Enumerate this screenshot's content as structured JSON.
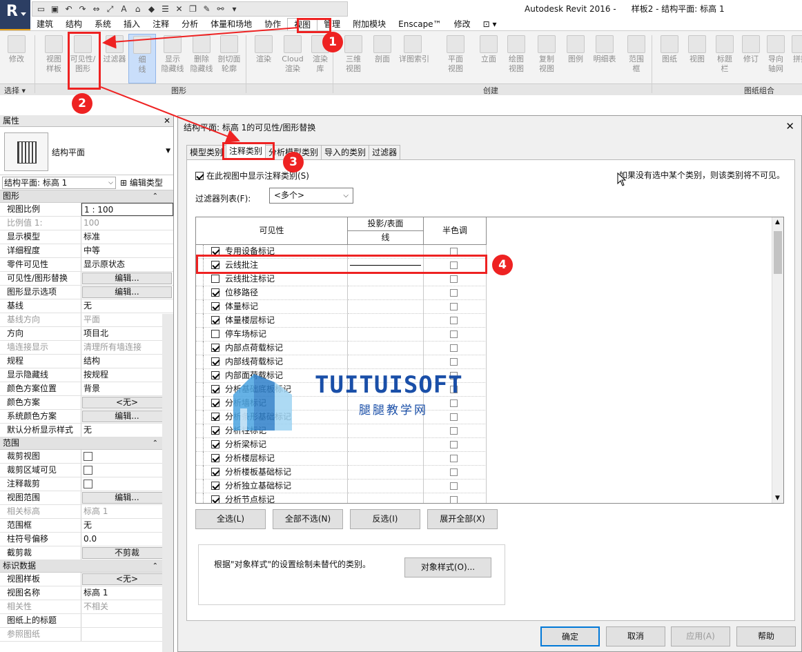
{
  "titlebar": {
    "app_name": "Autodesk Revit 2016 -",
    "doc_title": "样板2 - 结构平面: 标高 1"
  },
  "ribbon_tabs": [
    "建筑",
    "结构",
    "系统",
    "插入",
    "注释",
    "分析",
    "体量和场地",
    "协作",
    "视图",
    "管理",
    "附加模块",
    "Enscape™",
    "修改"
  ],
  "ribbon_buttons": [
    {
      "label": "修改",
      "icon": "cursor-icon"
    },
    {
      "label": "视图\n样板",
      "icon": "view-template-icon"
    },
    {
      "label": "可见性/\n图形",
      "icon": "visibility-graphics-icon"
    },
    {
      "label": "过滤器",
      "icon": "filter-icon"
    },
    {
      "label": "细\n线",
      "icon": "thin-lines-icon"
    },
    {
      "label": "显示\n隐藏线",
      "icon": "show-hidden-lines-icon"
    },
    {
      "label": "删除\n隐藏线",
      "icon": "remove-hidden-lines-icon"
    },
    {
      "label": "剖切面\n轮廓",
      "icon": "cut-profile-icon"
    },
    {
      "label": "渲染",
      "icon": "render-icon"
    },
    {
      "label": "Cloud\n渲染",
      "icon": "cloud-render-icon"
    },
    {
      "label": "渲染\n库",
      "icon": "render-gallery-icon"
    },
    {
      "label": "三维\n视图",
      "icon": "3d-view-icon"
    },
    {
      "label": "剖面",
      "icon": "section-icon"
    },
    {
      "label": "详图索引",
      "icon": "callout-icon"
    },
    {
      "label": "平面\n视图",
      "icon": "plan-view-icon"
    },
    {
      "label": "立面",
      "icon": "elevation-icon"
    },
    {
      "label": "绘图\n视图",
      "icon": "drafting-view-icon"
    },
    {
      "label": "复制\n视图",
      "icon": "duplicate-view-icon"
    },
    {
      "label": "图例",
      "icon": "legend-icon"
    },
    {
      "label": "明细表",
      "icon": "schedule-icon"
    },
    {
      "label": "范围\n框",
      "icon": "scope-box-icon"
    },
    {
      "label": "图纸",
      "icon": "sheet-icon"
    },
    {
      "label": "视图",
      "icon": "view-icon"
    },
    {
      "label": "标题\n栏",
      "icon": "title-block-icon"
    },
    {
      "label": "修订",
      "icon": "revisions-icon"
    },
    {
      "label": "导向\n轴网",
      "icon": "guide-grid-icon"
    },
    {
      "label": "拼接",
      "icon": "matchline-icon"
    }
  ],
  "ribbon_panels": {
    "select": "选择 ▾",
    "graphics": "图形",
    "create": "创建",
    "sheet_composition": "图纸组合"
  },
  "properties": {
    "title": "属性",
    "type_name": "结构平面",
    "view_selector": "结构平面: 标高 1",
    "edit_type": "编辑类型",
    "groups": [
      {
        "name": "图形",
        "rows": [
          {
            "k": "视图比例",
            "v": "1 : 100",
            "kind": "input"
          },
          {
            "k": "比例值 1:",
            "v": "100",
            "kind": "dis"
          },
          {
            "k": "显示模型",
            "v": "标准"
          },
          {
            "k": "详细程度",
            "v": "中等"
          },
          {
            "k": "零件可见性",
            "v": "显示原状态"
          },
          {
            "k": "可见性/图形替换",
            "v": "编辑...",
            "kind": "btn"
          },
          {
            "k": "图形显示选项",
            "v": "编辑...",
            "kind": "btn"
          },
          {
            "k": "基线",
            "v": "无"
          },
          {
            "k": "基线方向",
            "v": "平面",
            "kind": "dis"
          },
          {
            "k": "方向",
            "v": "项目北"
          },
          {
            "k": "墙连接显示",
            "v": "清理所有墙连接",
            "kind": "dis"
          },
          {
            "k": "规程",
            "v": "结构"
          },
          {
            "k": "显示隐藏线",
            "v": "按规程"
          },
          {
            "k": "颜色方案位置",
            "v": "背景"
          },
          {
            "k": "颜色方案",
            "v": "<无>",
            "kind": "btn"
          },
          {
            "k": "系统颜色方案",
            "v": "编辑...",
            "kind": "btn"
          },
          {
            "k": "默认分析显示样式",
            "v": "无"
          }
        ]
      },
      {
        "name": "范围",
        "rows": [
          {
            "k": "裁剪视图",
            "v": "",
            "kind": "chk"
          },
          {
            "k": "裁剪区域可见",
            "v": "",
            "kind": "chk"
          },
          {
            "k": "注释裁剪",
            "v": "",
            "kind": "chk"
          },
          {
            "k": "视图范围",
            "v": "编辑...",
            "kind": "btn"
          },
          {
            "k": "相关标高",
            "v": "标高 1",
            "kind": "dis"
          },
          {
            "k": "范围框",
            "v": "无"
          },
          {
            "k": "柱符号偏移",
            "v": "0.0"
          },
          {
            "k": "截剪裁",
            "v": "不剪裁",
            "kind": "btn"
          }
        ]
      },
      {
        "name": "标识数据",
        "rows": [
          {
            "k": "视图样板",
            "v": "<无>",
            "kind": "btn"
          },
          {
            "k": "视图名称",
            "v": "标高 1"
          },
          {
            "k": "相关性",
            "v": "不相关",
            "kind": "dis"
          },
          {
            "k": "图纸上的标题",
            "v": ""
          },
          {
            "k": "参照图纸",
            "v": "",
            "kind": "dis"
          }
        ]
      }
    ]
  },
  "dialog": {
    "title": "结构平面: 标高 1的可见性/图形替换",
    "tabs": [
      "模型类别",
      "注释类别",
      "分析模型类别",
      "导入的类别",
      "过滤器"
    ],
    "active_tab": 1,
    "show_checkbox": "在此视图中显示注释类别(S)",
    "hint": "如果没有选中某个类别，则该类别将不可见。",
    "filter_label": "过滤器列表(F):",
    "filter_value": "<多个>",
    "columns": {
      "visibility": "可见性",
      "projection": "投影/表面",
      "line": "线",
      "halftone": "半色调"
    },
    "rows": [
      {
        "label": "专用设备标记",
        "checked": true
      },
      {
        "label": "云线批注",
        "checked": true,
        "line": true
      },
      {
        "label": "云线批注标记",
        "checked": false
      },
      {
        "label": "位移路径",
        "checked": true
      },
      {
        "label": "体量标记",
        "checked": true
      },
      {
        "label": "体量楼层标记",
        "checked": true
      },
      {
        "label": "停车场标记",
        "checked": false
      },
      {
        "label": "内部点荷载标记",
        "checked": true
      },
      {
        "label": "内部线荷载标记",
        "checked": true
      },
      {
        "label": "内部面荷载标记",
        "checked": true
      },
      {
        "label": "分析基础底板标记",
        "checked": true
      },
      {
        "label": "分析墙标记",
        "checked": true
      },
      {
        "label": "分析条形基础标记",
        "checked": true
      },
      {
        "label": "分析柱标记",
        "checked": true
      },
      {
        "label": "分析梁标记",
        "checked": true
      },
      {
        "label": "分析楼层标记",
        "checked": true
      },
      {
        "label": "分析楼板基础标记",
        "checked": true
      },
      {
        "label": "分析独立基础标记",
        "checked": true
      },
      {
        "label": "分析节点标记",
        "checked": true
      }
    ],
    "buttons": {
      "select_all": "全选(L)",
      "select_none": "全部不选(N)",
      "invert": "反选(I)",
      "expand_all": "展开全部(X)"
    },
    "info_text": "根据\"对象样式\"的设置绘制未替代的类别。",
    "object_styles": "对象样式(O)...",
    "ok": "确定",
    "cancel": "取消",
    "apply": "应用(A)",
    "help": "帮助"
  },
  "watermark": {
    "brand": "TUITUISOFT",
    "sub": "腿腿教学网"
  },
  "annotations": [
    "1",
    "2",
    "3",
    "4"
  ],
  "colors": {
    "annotation_red": "#e22222",
    "selected_blue": "#c9defa",
    "app_blue": "#2c3e63"
  }
}
